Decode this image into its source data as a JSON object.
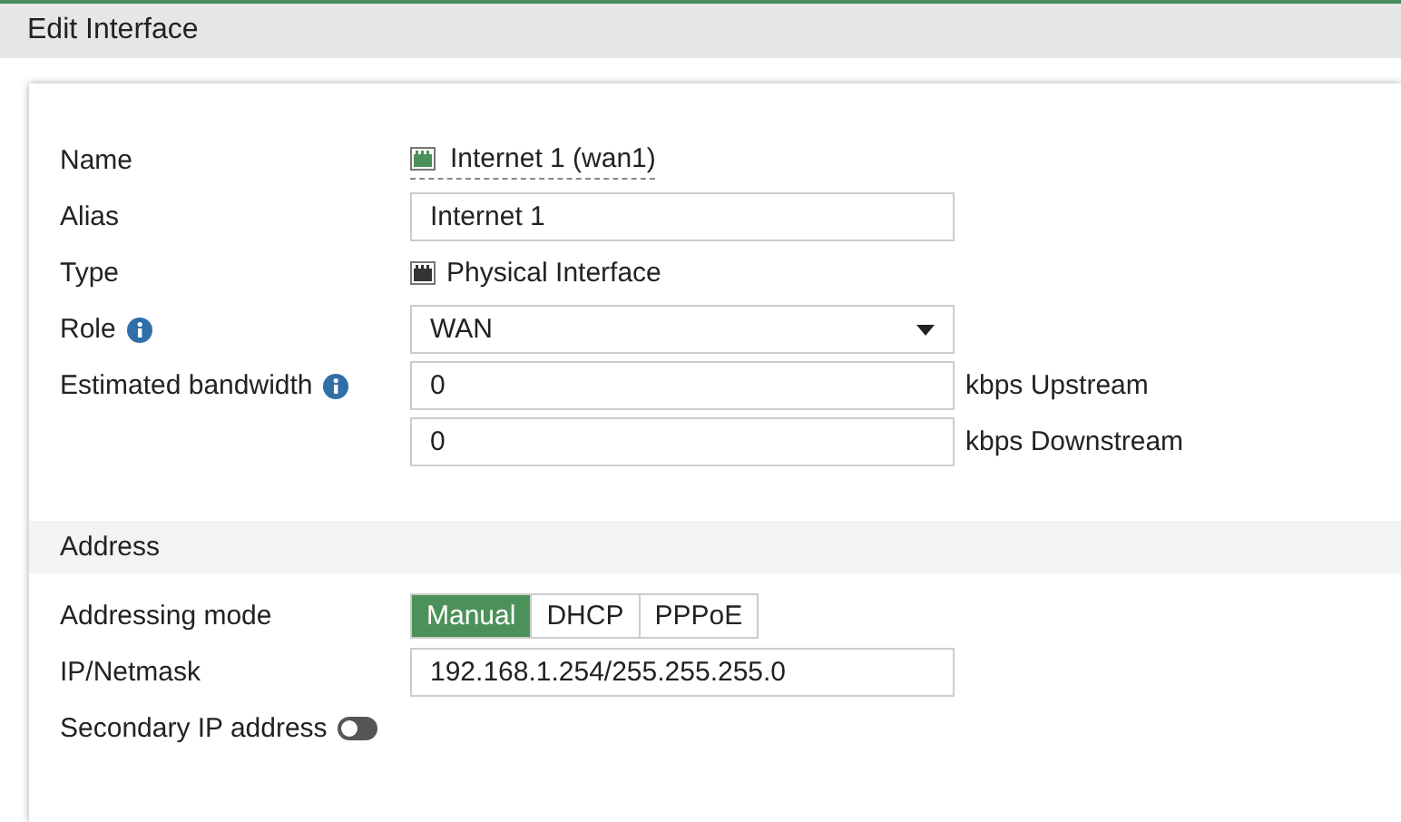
{
  "header": {
    "title": "Edit Interface"
  },
  "general": {
    "name": {
      "label": "Name",
      "value": "Internet 1 (wan1)"
    },
    "alias": {
      "label": "Alias",
      "value": "Internet 1"
    },
    "type": {
      "label": "Type",
      "value": "Physical Interface"
    },
    "role": {
      "label": "Role",
      "value": "WAN"
    },
    "bandwidth": {
      "label": "Estimated bandwidth",
      "upstream": {
        "value": "0",
        "unit": "kbps Upstream"
      },
      "downstream": {
        "value": "0",
        "unit": "kbps Downstream"
      }
    }
  },
  "address": {
    "title": "Address",
    "mode": {
      "label": "Addressing mode",
      "options": [
        {
          "label": "Manual",
          "selected": true
        },
        {
          "label": "DHCP",
          "selected": false
        },
        {
          "label": "PPPoE",
          "selected": false
        }
      ]
    },
    "ip": {
      "label": "IP/Netmask",
      "value": "192.168.1.254/255.255.255.0"
    },
    "secondary": {
      "label": "Secondary IP address",
      "on": false
    }
  }
}
